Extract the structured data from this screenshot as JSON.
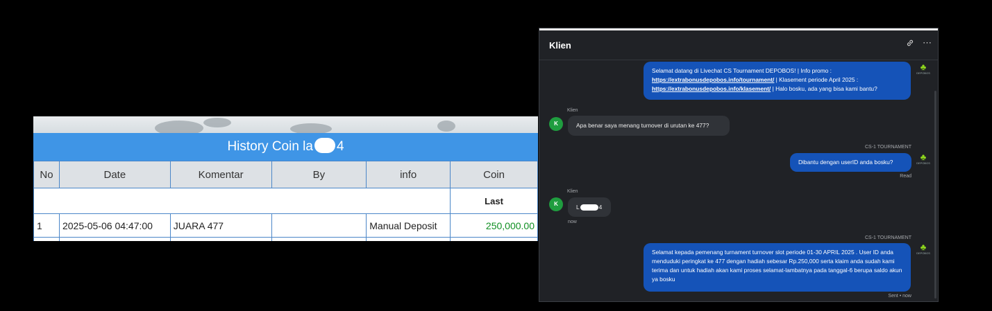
{
  "history": {
    "title_prefix": "History Coin la",
    "title_suffix": "4",
    "columns": [
      "No",
      "Date",
      "Komentar",
      "By",
      "info",
      "Coin"
    ],
    "subheader_last": "Last",
    "rows": [
      {
        "no": "1",
        "date": "2025-05-06 04:47:00",
        "komentar": "JUARA 477",
        "by": "",
        "info": "Manual Deposit",
        "coin": "250,000.00"
      }
    ],
    "coin_color": "#0f8f22",
    "header_color": "#3f95e6"
  },
  "chat": {
    "title": "Klien",
    "icons": {
      "link": "link-icon",
      "more": "more-icon"
    },
    "avatar_initial": "K",
    "agent_name": "CS-1 TOURNAMENT",
    "msg1": {
      "text_a": "Selamat datang di Livechat CS Tournament DEPOBOS! | Info promo :",
      "link1": "https://extrabonusdepobos.info/tournament/",
      "text_b": " | Klasement periode April 2025 :",
      "link2": "https://extrabonusdepobos.info/klasement/",
      "text_c": " | Halo bosku, ada yang bisa kami bantu?"
    },
    "msg2": {
      "sender": "Klien",
      "text": "Apa benar saya menang turnover di urutan ke 477?"
    },
    "msg3": {
      "sender": "CS-1 TOURNAMENT",
      "text": "Dibantu dengan userID anda bosku?",
      "status": "Read"
    },
    "msg4": {
      "sender": "Klien",
      "prefix": "L",
      "suffix": "4",
      "time": "now"
    },
    "msg5": {
      "sender": "CS-1 TOURNAMENT",
      "text": "Selamat kepada pemenang turnament turnover slot periode 01-30 APRIL 2025 . User ID anda menduduki peringkat ke 477 dengan hadiah sebesar Rp.250,000 serta klaim anda sudah kami terima dan untuk hadiah akan kami proses selamat-lambatnya pada tanggal-6 berupa saldo akun ya bosku",
      "status": "Sent • now"
    },
    "brand_color": "#1553b8"
  }
}
